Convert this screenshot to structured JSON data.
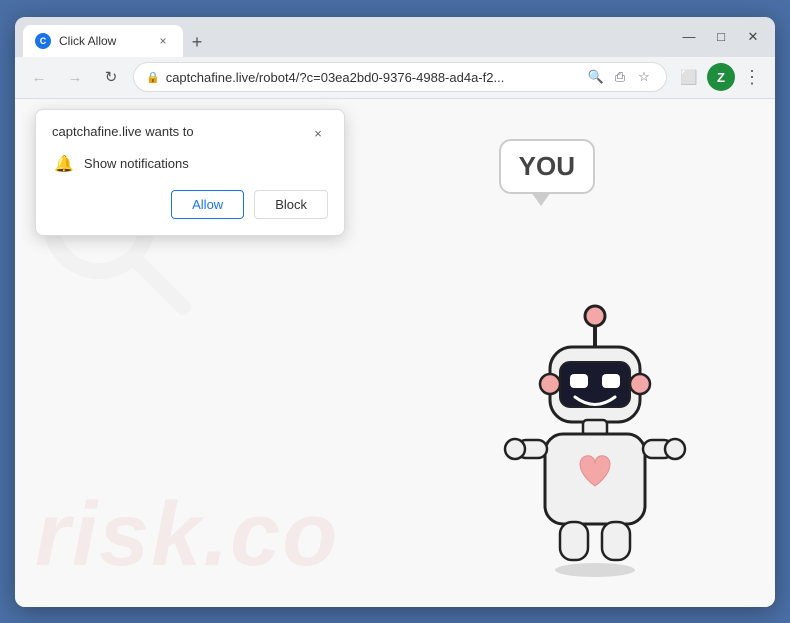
{
  "browser": {
    "tab": {
      "favicon_label": "C",
      "title": "Click Allow",
      "close_label": "×",
      "new_tab_label": "+"
    },
    "window_controls": {
      "minimize_label": "—",
      "maximize_label": "□",
      "close_label": "✕"
    },
    "nav": {
      "back_label": "←",
      "forward_label": "→",
      "reload_label": "↻"
    },
    "url_bar": {
      "lock_icon": "🔒",
      "url": "captchafine.live/robot4/?c=03ea2bd0-9376-4988-ad4a-f2...",
      "search_icon": "🔍",
      "share_icon": "⎙",
      "star_icon": "☆",
      "cast_icon": "⬜",
      "profile_initial": "Z"
    },
    "toolbar": {
      "ext_icon": "⊞",
      "menu_icon": "⋮"
    }
  },
  "notification_popup": {
    "title": "captchafine.live wants to",
    "close_label": "×",
    "bell_icon_label": "🔔",
    "notification_text": "Show notifications",
    "allow_label": "Allow",
    "block_label": "Block"
  },
  "page": {
    "speech_text": "YOU",
    "watermark_text": "risk.co",
    "robot_alt": "Robot illustration"
  }
}
